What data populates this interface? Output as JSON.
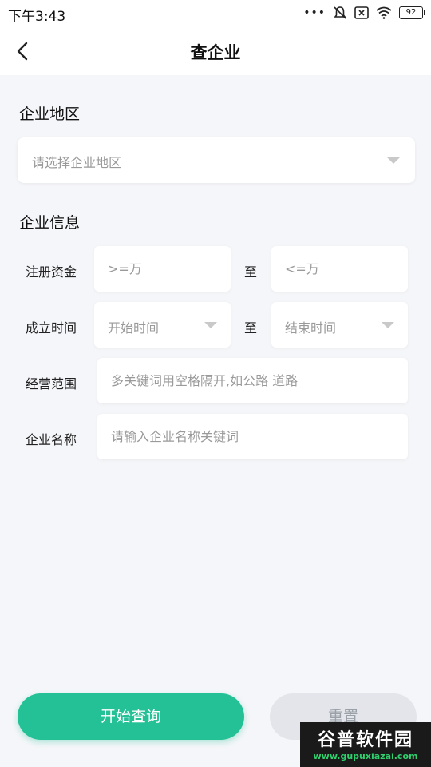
{
  "status_bar": {
    "time": "下午3:43",
    "battery": "92"
  },
  "header": {
    "title": "查企业"
  },
  "region_section": {
    "title": "企业地区",
    "select_placeholder": "请选择企业地区"
  },
  "info_section": {
    "title": "企业信息",
    "capital": {
      "label": "注册资金",
      "min_placeholder": ">=万",
      "to": "至",
      "max_placeholder": "<=万"
    },
    "founded": {
      "label": "成立时间",
      "start_placeholder": "开始时间",
      "to": "至",
      "end_placeholder": "结束时间"
    },
    "scope": {
      "label": "经营范围",
      "placeholder": "多关键词用空格隔开,如公路 道路"
    },
    "name": {
      "label": "企业名称",
      "placeholder": "请输入企业名称关键词"
    }
  },
  "actions": {
    "query_label": "开始查询",
    "reset_label": "重置"
  },
  "watermark": {
    "main": "谷普软件园",
    "sub": "www.gupuxiazai.com"
  },
  "colors": {
    "primary": "#24c196",
    "background": "#f5f6f9"
  }
}
